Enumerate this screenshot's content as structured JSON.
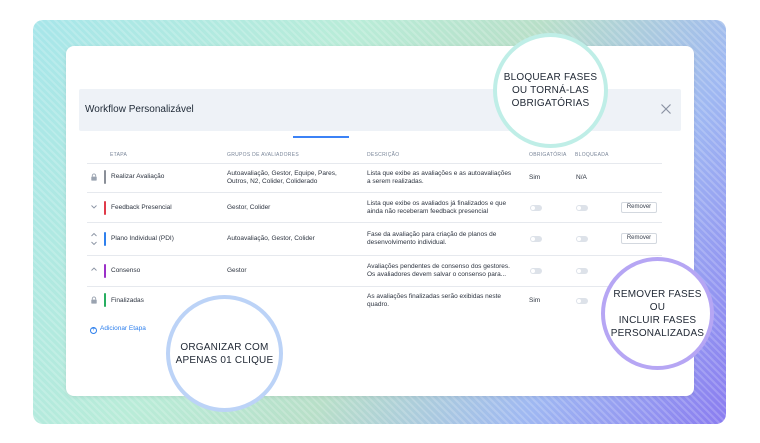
{
  "window": {
    "title": "Workflow Personalizável"
  },
  "columns": {
    "stage": "ETAPA",
    "groups": "GRUPOS DE AVALIADORES",
    "description": "DESCRIÇÃO",
    "mandatory": "OBRIGATÓRIA",
    "blocked": "BLOQUEADA"
  },
  "rows": [
    {
      "stage": "Realizar Avaliação",
      "color": "#8a8f98",
      "groups_line1": "Autoavaliação, Gestor, Equipe, Pares,",
      "groups_line2": "Outros, N2, Colider, Coliderado",
      "desc_line1": "Lista que exibe as avaliações e as autoavaliações",
      "desc_line2": "a serem realizadas.",
      "mandatory": "Sim",
      "blocked": "N/A",
      "control": "lock-icon"
    },
    {
      "stage": "Feedback Presencial",
      "color": "#e03b4a",
      "groups_line1": "Gestor, Colider",
      "desc_line1": "Lista que exibe os avaliados já finalizados e que",
      "desc_line2": "ainda não receberam feedback presencial",
      "action": "Remover",
      "control": "chevron-down-icon"
    },
    {
      "stage": "Plano Individual (PDI)",
      "color": "#2f80ed",
      "groups_line1": "Autoavaliação, Gestor, Colider",
      "desc_line1": "Fase da avaliação para criação de planos de",
      "desc_line2": "desenvolvimento individual.",
      "action": "Remover",
      "control": "chevron-up-down-icon"
    },
    {
      "stage": "Consenso",
      "color": "#9b30c8",
      "groups_line1": "Gestor",
      "desc_line1": "Avaliações pendentes de consenso dos gestores.",
      "desc_line2": "Os avaliadores devem salvar o consenso para...",
      "control": "chevron-up-icon"
    },
    {
      "stage": "Finalizadas",
      "color": "#27ae60",
      "desc_line1": "As avaliações finalizadas serão exibidas neste",
      "desc_line2": "quadro.",
      "mandatory": "Sim",
      "control": "lock-icon"
    }
  ],
  "add_stage": "Adicionar Etapa",
  "callouts": {
    "top": [
      "BLOQUEAR FASES",
      "OU TORNÁ-LAS",
      "OBRIGATÓRIAS"
    ],
    "bottom_left": [
      "ORGANIZAR COM",
      "APENAS 01 CLIQUE"
    ],
    "right": [
      "REMOVER FASES OU",
      "INCLUIR FASES",
      "PERSONALIZADAS"
    ]
  }
}
